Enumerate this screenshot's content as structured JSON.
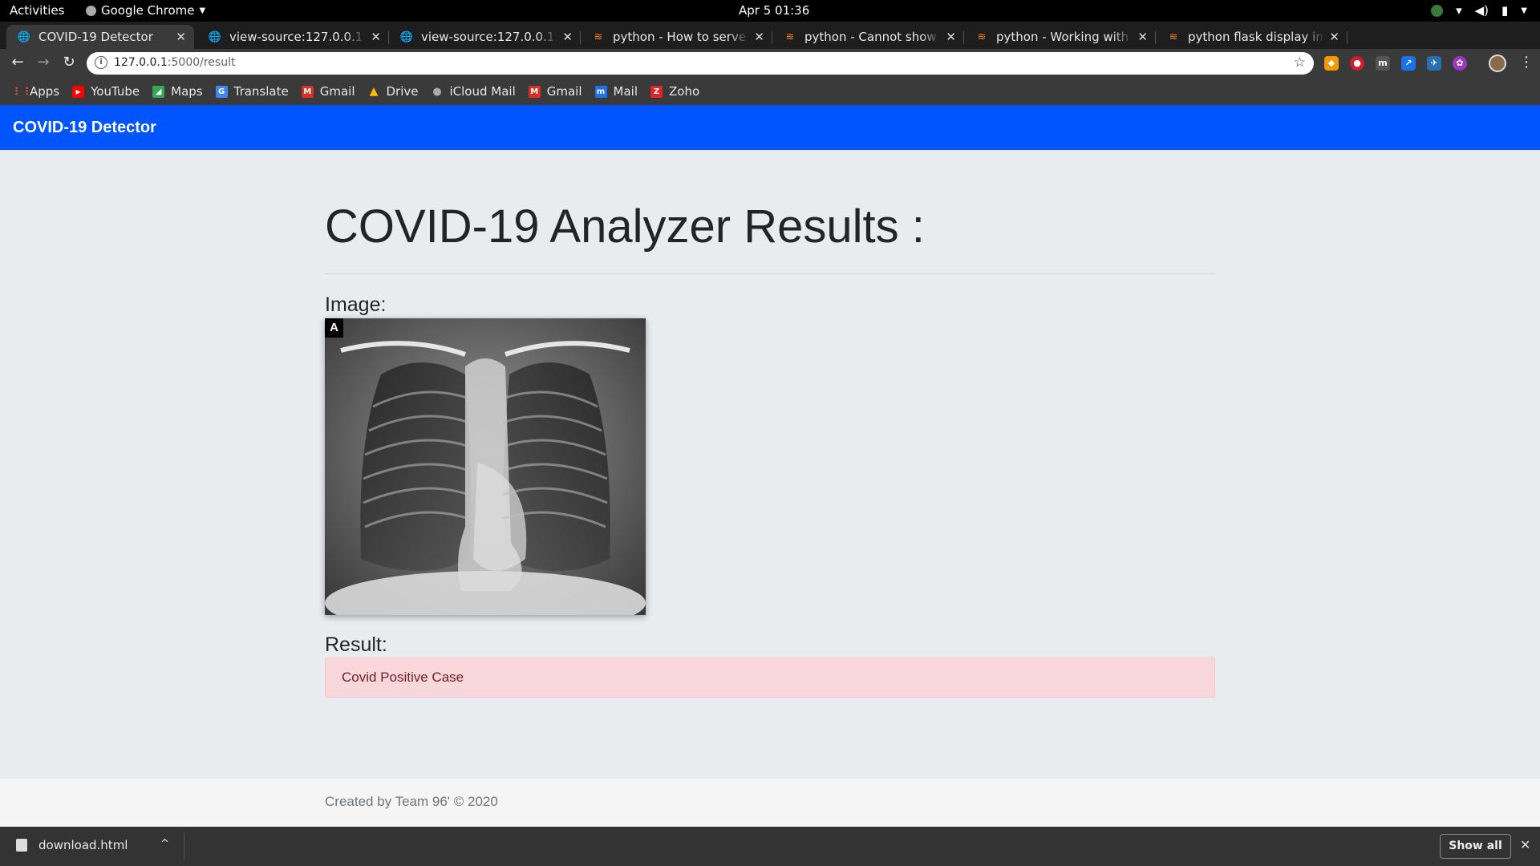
{
  "os_bar": {
    "activities": "Activities",
    "app_name": "Google Chrome",
    "datetime": "Apr 5  01:36"
  },
  "tabs": [
    {
      "label": "COVID-19 Detector",
      "active": true,
      "icon": "globe-icon"
    },
    {
      "label": "view-source:127.0.0.1:500",
      "active": false,
      "icon": "globe-icon"
    },
    {
      "label": "view-source:127.0.0.1:500",
      "active": false,
      "icon": "globe-icon"
    },
    {
      "label": "python - How to serve stat",
      "active": false,
      "icon": "stackoverflow-icon"
    },
    {
      "label": "python - Cannot show ima",
      "active": false,
      "icon": "stackoverflow-icon"
    },
    {
      "label": "python - Working with use",
      "active": false,
      "icon": "stackoverflow-icon"
    },
    {
      "label": "python flask display imag",
      "active": false,
      "icon": "stackoverflow-icon"
    }
  ],
  "address_bar": {
    "url_host": "127.0.0.1",
    "url_path": ":5000/result"
  },
  "bookmarks": [
    {
      "label": "Apps",
      "icon": "apps-grid-icon",
      "color": "#e8453c"
    },
    {
      "label": "YouTube",
      "icon": "youtube-icon",
      "color": "#ff0000"
    },
    {
      "label": "Maps",
      "icon": "maps-icon",
      "color": "#34a853"
    },
    {
      "label": "Translate",
      "icon": "translate-icon",
      "color": "#4285f4"
    },
    {
      "label": "Gmail",
      "icon": "gmail-icon",
      "color": "#d93025"
    },
    {
      "label": "Drive",
      "icon": "drive-icon",
      "color": "#fbbc04"
    },
    {
      "label": "iCloud Mail",
      "icon": "apple-icon",
      "color": "#aaaaaa"
    },
    {
      "label": "Gmail",
      "icon": "gmail-icon",
      "color": "#d93025"
    },
    {
      "label": "Mail",
      "icon": "mail-icon",
      "color": "#1a73e8"
    },
    {
      "label": "Zoho",
      "icon": "zoho-icon",
      "color": "#e42527"
    }
  ],
  "navbar": {
    "brand": "COVID-19 Detector",
    "color": "#0055ff"
  },
  "page": {
    "title": "COVID-19 Analyzer Results :",
    "image_label": "Image:",
    "image_tag": "A",
    "result_label": "Result:",
    "result_text": "Covid Positive Case"
  },
  "footer": {
    "text": "Created by Team 96' © 2020"
  },
  "download_bar": {
    "filename": "download.html",
    "show_all": "Show all"
  }
}
